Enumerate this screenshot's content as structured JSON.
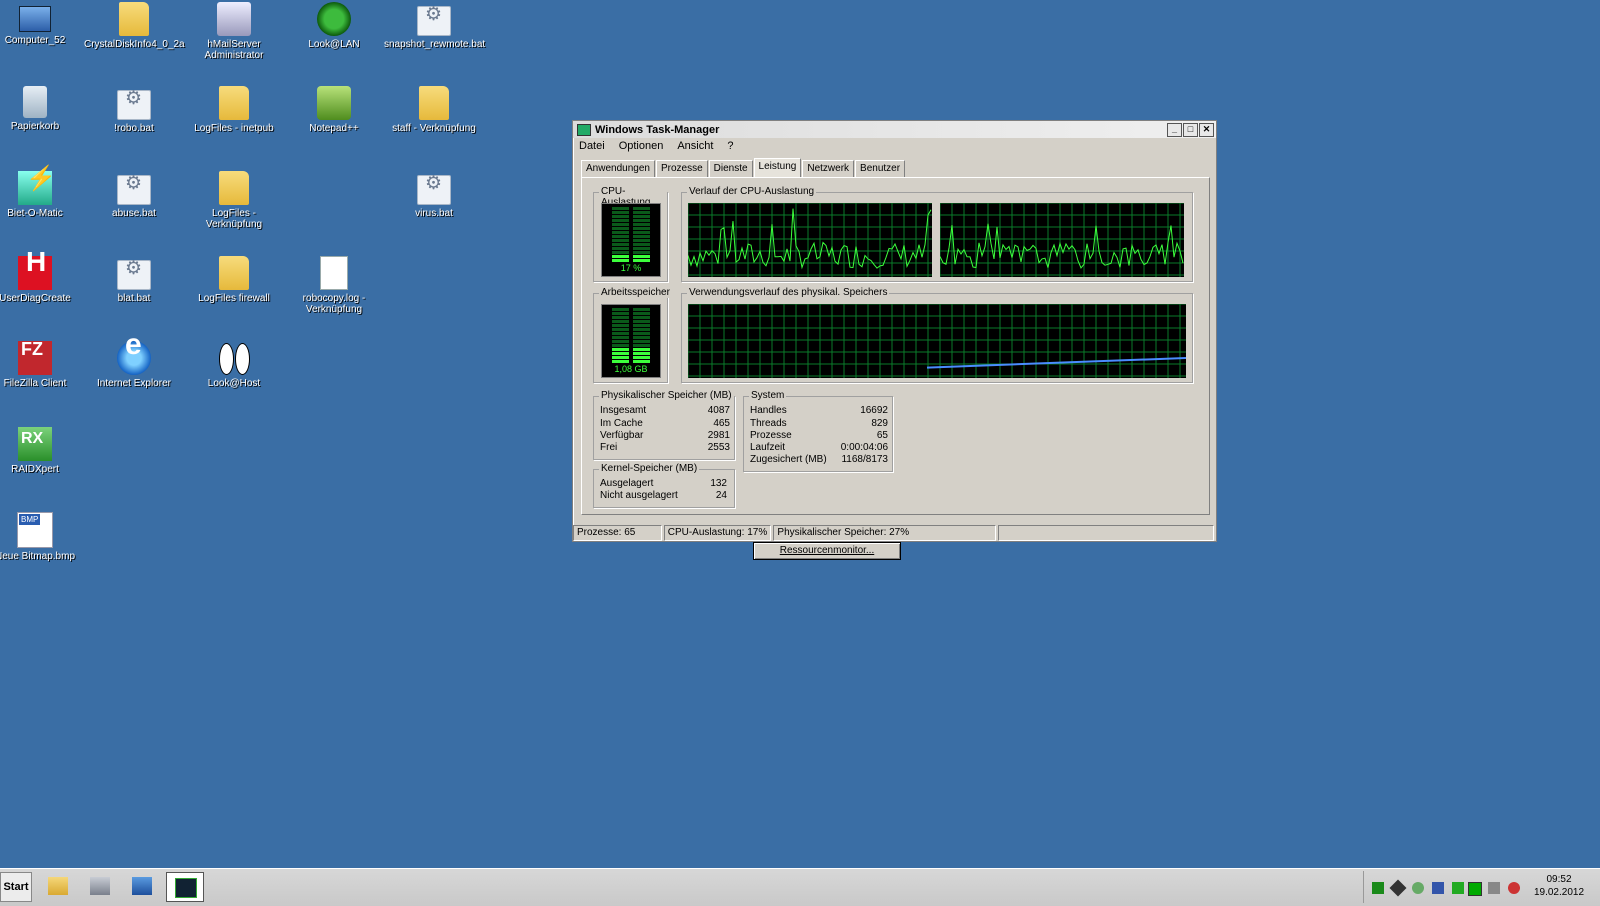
{
  "desktop": {
    "icons": [
      {
        "label": "Computer_52",
        "icon": "computer-icon"
      },
      {
        "label": "CrystalDiskInfo4_0_2a",
        "icon": "folder-icon"
      },
      {
        "label": "hMailServer Administrator",
        "icon": "hmailserver-icon"
      },
      {
        "label": "Look@LAN",
        "icon": "look-at-lan-icon"
      },
      {
        "label": "snapshot_rewmote.bat",
        "icon": "batch-file-icon"
      },
      {
        "label": "Papierkorb",
        "icon": "recycle-bin-icon"
      },
      {
        "label": "!robo.bat",
        "icon": "batch-file-icon"
      },
      {
        "label": "LogFiles - inetpub",
        "icon": "folder-icon"
      },
      {
        "label": "Notepad++",
        "icon": "notepad-plus-icon"
      },
      {
        "label": "staff - Verknüpfung",
        "icon": "folder-icon"
      },
      {
        "label": "Biet-O-Matic",
        "icon": "biet-o-matic-icon"
      },
      {
        "label": "abuse.bat",
        "icon": "batch-file-icon"
      },
      {
        "label": "LogFiles - Verknüpfung",
        "icon": "folder-icon"
      },
      {
        "label": "virus.bat",
        "icon": "batch-file-icon"
      },
      {
        "label": "UserDiagCreate",
        "icon": "userdiag-icon"
      },
      {
        "label": "blat.bat",
        "icon": "batch-file-icon"
      },
      {
        "label": "LogFiles firewall",
        "icon": "folder-icon"
      },
      {
        "label": "robocopy.log - Verknüpfung",
        "icon": "text-document-icon"
      },
      {
        "label": "FileZilla Client",
        "icon": "filezilla-icon"
      },
      {
        "label": "Internet Explorer",
        "icon": "internet-explorer-icon"
      },
      {
        "label": "Look@Host",
        "icon": "look-at-host-icon"
      },
      {
        "label": "RAIDXpert",
        "icon": "raidxpert-icon"
      },
      {
        "label": "Neue Bitmap.bmp",
        "icon": "bitmap-file-icon"
      }
    ]
  },
  "taskmanager": {
    "title": "Windows Task-Manager",
    "menu": [
      "Datei",
      "Optionen",
      "Ansicht",
      "?"
    ],
    "tabs": [
      "Anwendungen",
      "Prozesse",
      "Dienste",
      "Leistung",
      "Netzwerk",
      "Benutzer"
    ],
    "active_tab": "Leistung",
    "cpu_group": "CPU-Auslastung",
    "cpu_value": "17 %",
    "cpu_fraction": 0.17,
    "cpu_history_group": "Verlauf der CPU-Auslastung",
    "mem_group": "Arbeitsspeicher",
    "mem_value": "1,08 GB",
    "mem_fraction": 0.27,
    "mem_history_group": "Verwendungsverlauf des physikal. Speichers",
    "phys": {
      "title": "Physikalischer Speicher (MB)",
      "rows": [
        {
          "label": "Insgesamt",
          "value": "4087"
        },
        {
          "label": "Im Cache",
          "value": "465"
        },
        {
          "label": "Verfügbar",
          "value": "2981"
        },
        {
          "label": "Frei",
          "value": "2553"
        }
      ]
    },
    "kernel": {
      "title": "Kernel-Speicher (MB)",
      "rows": [
        {
          "label": "Ausgelagert",
          "value": "132"
        },
        {
          "label": "Nicht ausgelagert",
          "value": "24"
        }
      ]
    },
    "system": {
      "title": "System",
      "rows": [
        {
          "label": "Handles",
          "value": "16692"
        },
        {
          "label": "Threads",
          "value": "829"
        },
        {
          "label": "Prozesse",
          "value": "65"
        },
        {
          "label": "Laufzeit",
          "value": "0:00:04:06"
        },
        {
          "label": "Zugesichert (MB)",
          "value": "1168/8173"
        }
      ]
    },
    "resmon_button": "Ressourcenmonitor...",
    "status": {
      "processes": "Prozesse: 65",
      "cpu": "CPU-Auslastung: 17%",
      "memory": "Physikalischer Speicher: 27%"
    }
  },
  "taskbar": {
    "start_label": "Start",
    "clock_time": "09:52",
    "clock_date": "19.02.2012"
  },
  "colors": {
    "desktop": "#3a6ea5",
    "graph_line": "#3cff3c",
    "graph_grid": "#0a7a2a",
    "mem_line": "#4a8cff"
  }
}
